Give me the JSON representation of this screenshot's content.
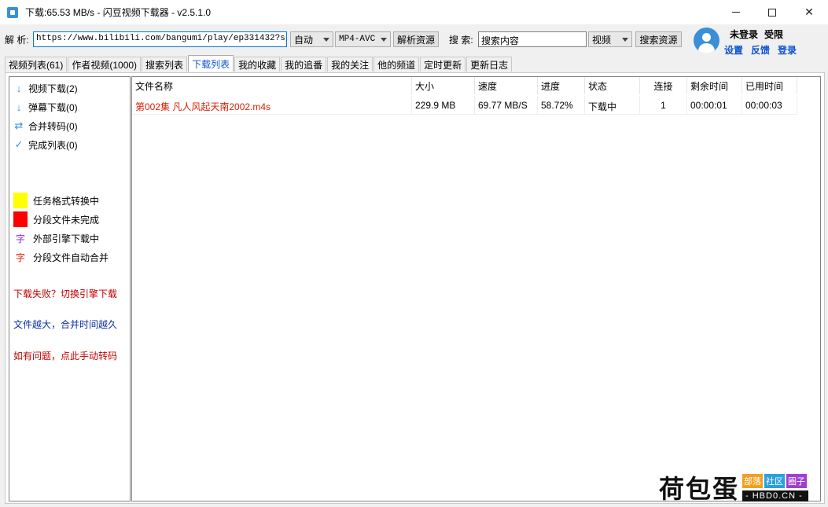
{
  "window": {
    "title": "下载:65.53 MB/s - 闪豆视频下载器 - v2.5.1.0"
  },
  "toolbar": {
    "parse_label": "解 析:",
    "url_value": "https://www.bilibili.com/bangumi/play/ep331432?spm_id",
    "quality_select": "自动",
    "format_select": "MP4-AVC",
    "parse_button": "解析资源",
    "search_label": "搜 索:",
    "search_value": "搜索内容",
    "search_type_select": "视频",
    "search_button": "搜索资源"
  },
  "user": {
    "status_login": "未登录",
    "status_limit": "受限",
    "link_settings": "设置",
    "link_feedback": "反馈",
    "link_login": "登录"
  },
  "tabs": [
    {
      "label": "视频列表(61)"
    },
    {
      "label": "作者视频(1000)"
    },
    {
      "label": "搜索列表"
    },
    {
      "label": "下载列表",
      "active": true
    },
    {
      "label": "我的收藏"
    },
    {
      "label": "我的追番"
    },
    {
      "label": "我的关注"
    },
    {
      "label": "他的频道"
    },
    {
      "label": "定时更新"
    },
    {
      "label": "更新日志"
    }
  ],
  "sidebar": {
    "items": [
      {
        "label": "视频下载(2)",
        "icon": "arrow-down-icon"
      },
      {
        "label": "弹幕下载(0)",
        "icon": "arrow-down-icon"
      },
      {
        "label": "合并转码(0)",
        "icon": "swap-icon"
      },
      {
        "label": "完成列表(0)",
        "icon": "check-icon"
      }
    ],
    "legend": [
      {
        "label": "任务格式转换中",
        "color": "#ffff00"
      },
      {
        "label": "分段文件未完成",
        "color": "#ff0000"
      },
      {
        "label": "外部引擎下载中",
        "glyph": "字",
        "color": "#8a2be2"
      },
      {
        "label": "分段文件自动合并",
        "glyph": "字",
        "color": "#d81e06"
      }
    ],
    "notes": [
      {
        "text": "下载失败？切换引擎下载",
        "color": "#c00000"
      },
      {
        "text": "文件越大，合并时间越久",
        "color": "#0b2fa8"
      },
      {
        "text": "如有问题，点此手动转码",
        "color": "#c00000"
      }
    ]
  },
  "table": {
    "headers": [
      "文件名称",
      "大小",
      "速度",
      "进度",
      "状态",
      "连接",
      "剩余时间",
      "已用时间"
    ],
    "rows": [
      {
        "name": "第002集 凡人风起天南2002.m4s",
        "size": "229.9 MB",
        "speed": "69.77 MB/S",
        "progress": "58.72%",
        "status": "下载中",
        "connections": "1",
        "remaining": "00:00:01",
        "elapsed": "00:00:03",
        "name_color": "#d81e06"
      }
    ]
  },
  "watermark": {
    "big": "荷包蛋",
    "tags": [
      {
        "text": "部落",
        "color": "#f0a020"
      },
      {
        "text": "社区",
        "color": "#2aa0e0"
      },
      {
        "text": "圈子",
        "color": "#a040d0"
      }
    ],
    "domain": "- HBD0.CN -"
  }
}
